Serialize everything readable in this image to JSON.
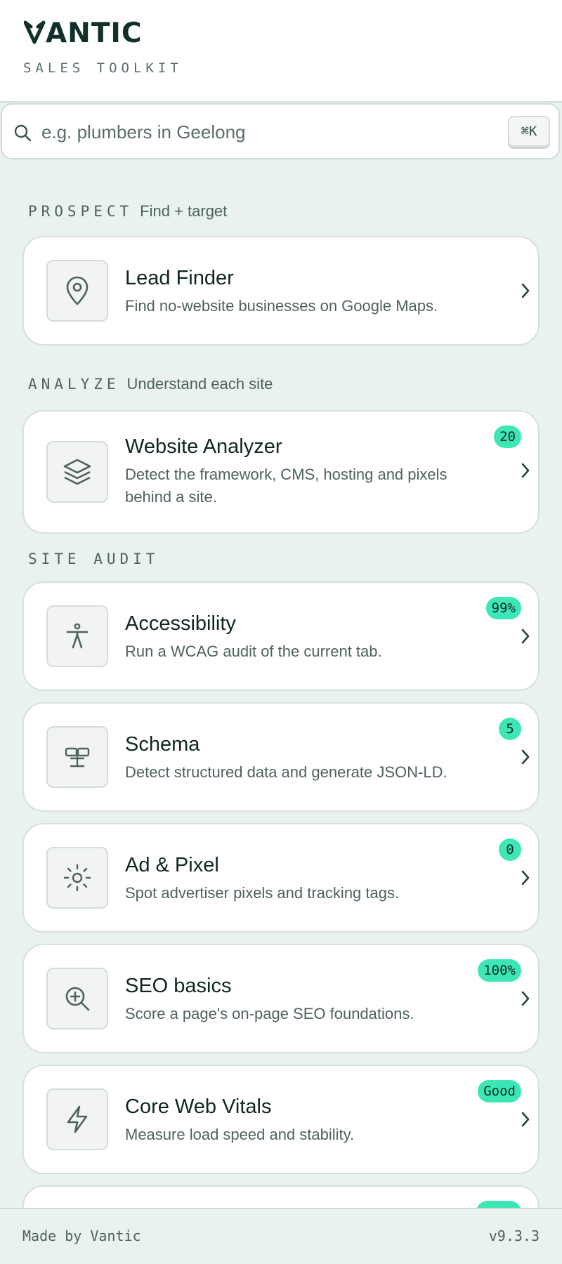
{
  "app": {
    "brand": "VANTIC",
    "tagline": "SALES TOOLKIT"
  },
  "search": {
    "placeholder": "e.g. plumbers in Geelong",
    "value": "",
    "shortcut": "⌘K"
  },
  "sections": {
    "prospect": {
      "title": "PROSPECT",
      "subtitle": "Find + target"
    },
    "analyze": {
      "title": "ANALYZE",
      "subtitle": "Understand each site"
    },
    "site_audit": {
      "title": "SITE AUDIT"
    }
  },
  "tools": [
    {
      "title": "Lead Finder",
      "description": "Find no-website businesses on Google Maps.",
      "badge": "",
      "icon": "map-pin-icon"
    },
    {
      "title": "Website Analyzer",
      "description": "Detect the framework, CMS, hosting and pixels behind a site.",
      "badge": "20",
      "icon": "layers-icon"
    },
    {
      "title": "Accessibility",
      "description": "Run a WCAG audit of the current tab.",
      "badge": "99%",
      "icon": "accessibility-icon"
    },
    {
      "title": "Schema",
      "description": "Detect structured data and generate JSON-LD.",
      "badge": "5",
      "icon": "schema-icon"
    },
    {
      "title": "Ad & Pixel",
      "description": "Spot advertiser pixels and tracking tags.",
      "badge": "0",
      "icon": "sun-icon"
    },
    {
      "title": "SEO basics",
      "description": "Score a page's on-page SEO foundations.",
      "badge": "100%",
      "icon": "zoom-in-icon"
    },
    {
      "title": "Core Web Vitals",
      "description": "Measure load speed and stability.",
      "badge": "Good",
      "icon": "lightning-icon"
    }
  ],
  "footer": {
    "credit": "Made by Vantic",
    "version": "v9.3.3"
  },
  "colors": {
    "accent": "#3ce7b5",
    "background": "#e9f2ee",
    "card": "#ffffff",
    "text": "#10261f"
  }
}
